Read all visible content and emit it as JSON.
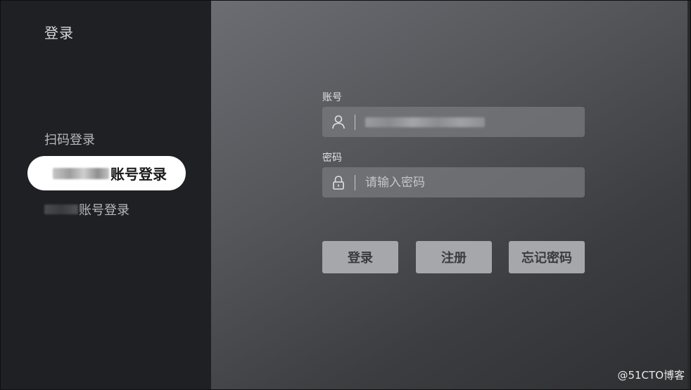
{
  "sidebar": {
    "title": "登录",
    "items": [
      {
        "label": "扫码登录"
      },
      {
        "label": "账号登录"
      },
      {
        "label": "账号登录"
      }
    ]
  },
  "form": {
    "account_label": "账号",
    "password_label": "密码",
    "password_placeholder": "请输入密码"
  },
  "buttons": {
    "login": "登录",
    "register": "注册",
    "forgot": "忘记密码"
  },
  "watermark": "@51CTO博客",
  "icons": {
    "account": "user-icon",
    "password": "lock-icon"
  }
}
